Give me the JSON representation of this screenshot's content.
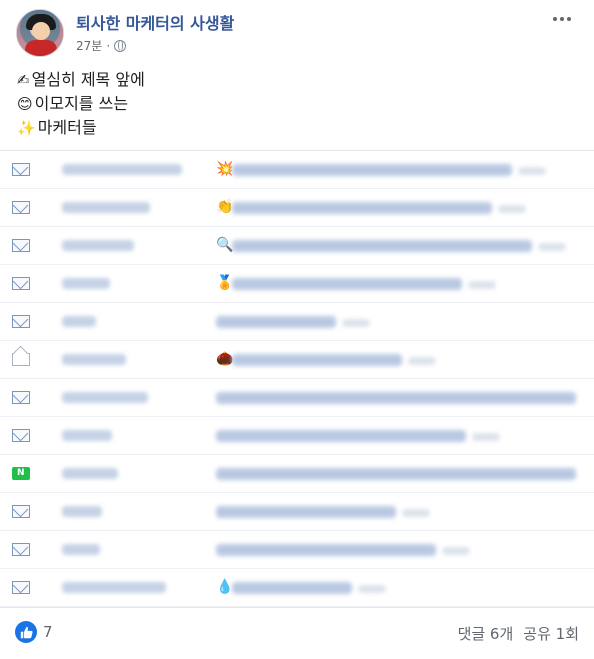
{
  "post": {
    "page_name": "퇴사한 마케터의 사생활",
    "time": "27분",
    "separator": "·",
    "lines": [
      {
        "emoji": "✍",
        "text": "열심히 제목 앞에"
      },
      {
        "emoji": "😊",
        "text": "이모지를 쓰는"
      },
      {
        "emoji": "✨",
        "text": "마케터들"
      }
    ]
  },
  "mail_rows": [
    {
      "icon": "envelope-icon",
      "emoji": "💥"
    },
    {
      "icon": "envelope-icon",
      "emoji": "👏"
    },
    {
      "icon": "envelope-icon",
      "emoji": "🔍"
    },
    {
      "icon": "envelope-icon",
      "emoji": "🏅"
    },
    {
      "icon": "envelope-icon",
      "emoji": ""
    },
    {
      "icon": "open-envelope-icon",
      "emoji": "🌰"
    },
    {
      "icon": "envelope-icon",
      "emoji": ""
    },
    {
      "icon": "envelope-icon",
      "emoji": ""
    },
    {
      "icon": "naver-icon",
      "emoji": ""
    },
    {
      "icon": "envelope-icon",
      "emoji": ""
    },
    {
      "icon": "envelope-icon",
      "emoji": ""
    },
    {
      "icon": "envelope-icon",
      "emoji": "💧"
    }
  ],
  "footer": {
    "like_count": "7",
    "comments": "댓글 6개",
    "shares": "공유 1회"
  },
  "colors": {
    "page_name": "#365899",
    "like_badge": "#1b74e4",
    "naver": "#1fbf4a"
  }
}
